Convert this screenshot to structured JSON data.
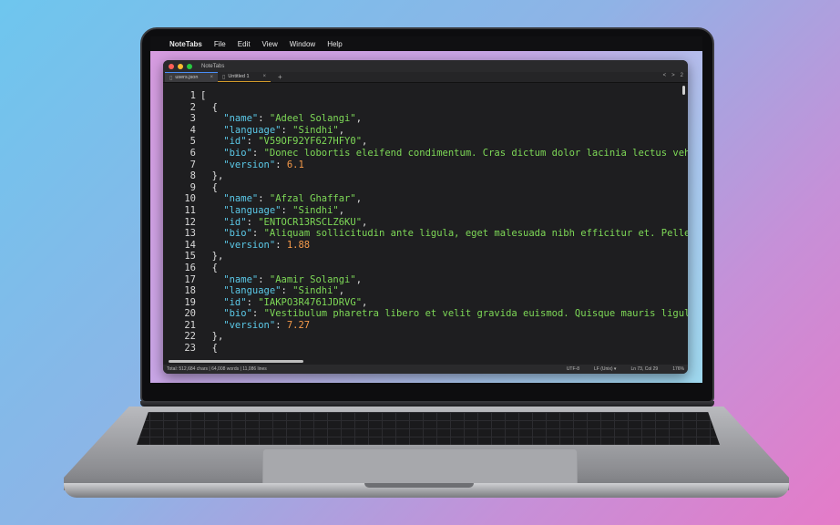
{
  "menubar": {
    "app": "NoteTabs",
    "items": [
      "File",
      "Edit",
      "View",
      "Window",
      "Help"
    ]
  },
  "window": {
    "title": "NoteTabs"
  },
  "tabs": [
    {
      "label": "users.json",
      "active": true
    },
    {
      "label": "Untitled 1",
      "active": false
    }
  ],
  "tabnav": [
    "<",
    ">",
    "2"
  ],
  "editor": {
    "lines": [
      [
        {
          "t": "p",
          "v": "["
        }
      ],
      [
        {
          "t": "p",
          "v": "  {"
        }
      ],
      [
        {
          "t": "k",
          "v": "    \"name\""
        },
        {
          "t": "p",
          "v": ": "
        },
        {
          "t": "s",
          "v": "\"Adeel Solangi\""
        },
        {
          "t": "p",
          "v": ","
        }
      ],
      [
        {
          "t": "k",
          "v": "    \"language\""
        },
        {
          "t": "p",
          "v": ": "
        },
        {
          "t": "s",
          "v": "\"Sindhi\""
        },
        {
          "t": "p",
          "v": ","
        }
      ],
      [
        {
          "t": "k",
          "v": "    \"id\""
        },
        {
          "t": "p",
          "v": ": "
        },
        {
          "t": "s",
          "v": "\"V59OF92YF627HFY0\""
        },
        {
          "t": "p",
          "v": ","
        }
      ],
      [
        {
          "t": "k",
          "v": "    \"bio\""
        },
        {
          "t": "p",
          "v": ": "
        },
        {
          "t": "s",
          "v": "\"Donec lobortis eleifend condimentum. Cras dictum dolor lacinia lectus vehicula rutrum. Mae"
        }
      ],
      [
        {
          "t": "k",
          "v": "    \"version\""
        },
        {
          "t": "p",
          "v": ": "
        },
        {
          "t": "n",
          "v": "6.1"
        }
      ],
      [
        {
          "t": "p",
          "v": "  },"
        }
      ],
      [
        {
          "t": "p",
          "v": "  {"
        }
      ],
      [
        {
          "t": "k",
          "v": "    \"name\""
        },
        {
          "t": "p",
          "v": ": "
        },
        {
          "t": "s",
          "v": "\"Afzal Ghaffar\""
        },
        {
          "t": "p",
          "v": ","
        }
      ],
      [
        {
          "t": "k",
          "v": "    \"language\""
        },
        {
          "t": "p",
          "v": ": "
        },
        {
          "t": "s",
          "v": "\"Sindhi\""
        },
        {
          "t": "p",
          "v": ","
        }
      ],
      [
        {
          "t": "k",
          "v": "    \"id\""
        },
        {
          "t": "p",
          "v": ": "
        },
        {
          "t": "s",
          "v": "\"ENTOCR13RSCLZ6KU\""
        },
        {
          "t": "p",
          "v": ","
        }
      ],
      [
        {
          "t": "k",
          "v": "    \"bio\""
        },
        {
          "t": "p",
          "v": ": "
        },
        {
          "t": "s",
          "v": "\"Aliquam sollicitudin ante ligula, eget malesuada nibh efficitur et. Pellentesque massa sem, s"
        }
      ],
      [
        {
          "t": "k",
          "v": "    \"version\""
        },
        {
          "t": "p",
          "v": ": "
        },
        {
          "t": "n",
          "v": "1.88"
        }
      ],
      [
        {
          "t": "p",
          "v": "  },"
        }
      ],
      [
        {
          "t": "p",
          "v": "  {"
        }
      ],
      [
        {
          "t": "k",
          "v": "    \"name\""
        },
        {
          "t": "p",
          "v": ": "
        },
        {
          "t": "s",
          "v": "\"Aamir Solangi\""
        },
        {
          "t": "p",
          "v": ","
        }
      ],
      [
        {
          "t": "k",
          "v": "    \"language\""
        },
        {
          "t": "p",
          "v": ": "
        },
        {
          "t": "s",
          "v": "\"Sindhi\""
        },
        {
          "t": "p",
          "v": ","
        }
      ],
      [
        {
          "t": "k",
          "v": "    \"id\""
        },
        {
          "t": "p",
          "v": ": "
        },
        {
          "t": "s",
          "v": "\"IAKPO3R4761JDRVG\""
        },
        {
          "t": "p",
          "v": ","
        }
      ],
      [
        {
          "t": "k",
          "v": "    \"bio\""
        },
        {
          "t": "p",
          "v": ": "
        },
        {
          "t": "s",
          "v": "\"Vestibulum pharetra libero et velit gravida euismod. Quisque mauris ligula, efficitur porttito"
        }
      ],
      [
        {
          "t": "k",
          "v": "    \"version\""
        },
        {
          "t": "p",
          "v": ": "
        },
        {
          "t": "n",
          "v": "7.27"
        }
      ],
      [
        {
          "t": "p",
          "v": "  },"
        }
      ],
      [
        {
          "t": "p",
          "v": "  {"
        }
      ]
    ]
  },
  "statusbar": {
    "stats": "Total: 512,684 chars | 64,008 words | 11,086 lines",
    "encoding": "UTF-8",
    "line_endings": "LF (Unix) ▾",
    "position": "Ln 73, Col 29",
    "zoom": "176%"
  },
  "dock": {
    "icons": [
      {
        "name": "finder-icon",
        "color": "#3d8ef0"
      },
      {
        "name": "launchpad-icon",
        "color": "#e8663c"
      },
      {
        "name": "notes-icon",
        "color": "#f3f3f3"
      },
      {
        "name": "calculator-icon",
        "color": "#9a9a9a"
      },
      {
        "name": "mail-icon",
        "color": "#3a7be0"
      },
      {
        "name": "safari-icon",
        "color": "#3fa0f0"
      },
      {
        "name": "xcode-icon",
        "color": "#2d7de8"
      },
      {
        "name": "terminal-icon",
        "color": "#2a2a2a"
      },
      {
        "name": "calendar-icon",
        "color": "#f5f5f5"
      },
      {
        "name": "photos-icon",
        "color": "#f0c040"
      },
      {
        "name": "stickies-icon",
        "color": "#f3e27a"
      },
      {
        "name": "notetabs-icon",
        "color": "#e6e6e6"
      },
      {
        "name": "appstore-icon",
        "color": "#2f8cf0"
      },
      {
        "name": "settings-icon",
        "color": "#8a8a8e"
      },
      {
        "name": "preview-icon",
        "color": "#c8d2e0"
      },
      {
        "name": "files-icon",
        "color": "#4a6ee0"
      },
      {
        "name": "downloads-icon",
        "color": "#d8d8dc"
      },
      {
        "name": "trash-icon",
        "color": "#b4b4b8"
      }
    ]
  }
}
